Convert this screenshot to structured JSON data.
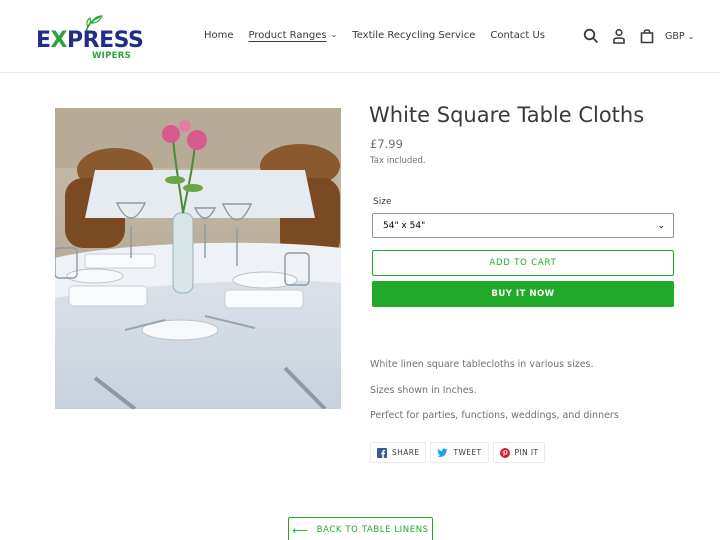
{
  "brand": {
    "logo_main": "EXPRESS",
    "logo_sub": "WIPERS"
  },
  "nav": {
    "items": [
      {
        "label": "Home"
      },
      {
        "label": "Product Ranges"
      },
      {
        "label": "Textile Recycling Service"
      },
      {
        "label": "Contact Us"
      }
    ]
  },
  "header_icons": [
    "search-icon",
    "account-icon",
    "cart-icon"
  ],
  "currency": "GBP",
  "product": {
    "title": "White Square Table Cloths",
    "price": "£7.99",
    "tax_note": "Tax included.",
    "size_label": "Size",
    "size_value": "54\" x 54\"",
    "add_to_cart": "ADD TO CART",
    "buy_now": "BUY IT NOW",
    "description": [
      "White linen square tablecloths in various sizes.",
      "Sizes shown in Inches.",
      "Perfect for parties, functions, weddings, and dinners"
    ]
  },
  "share": {
    "facebook": "SHARE",
    "twitter": "TWEET",
    "pinterest": "PIN IT"
  },
  "back_link": "BACK TO TABLE LINENS",
  "colors": {
    "accent": "#21a929",
    "brand_blue": "#1f2f87",
    "brand_green": "#2aa53c"
  }
}
